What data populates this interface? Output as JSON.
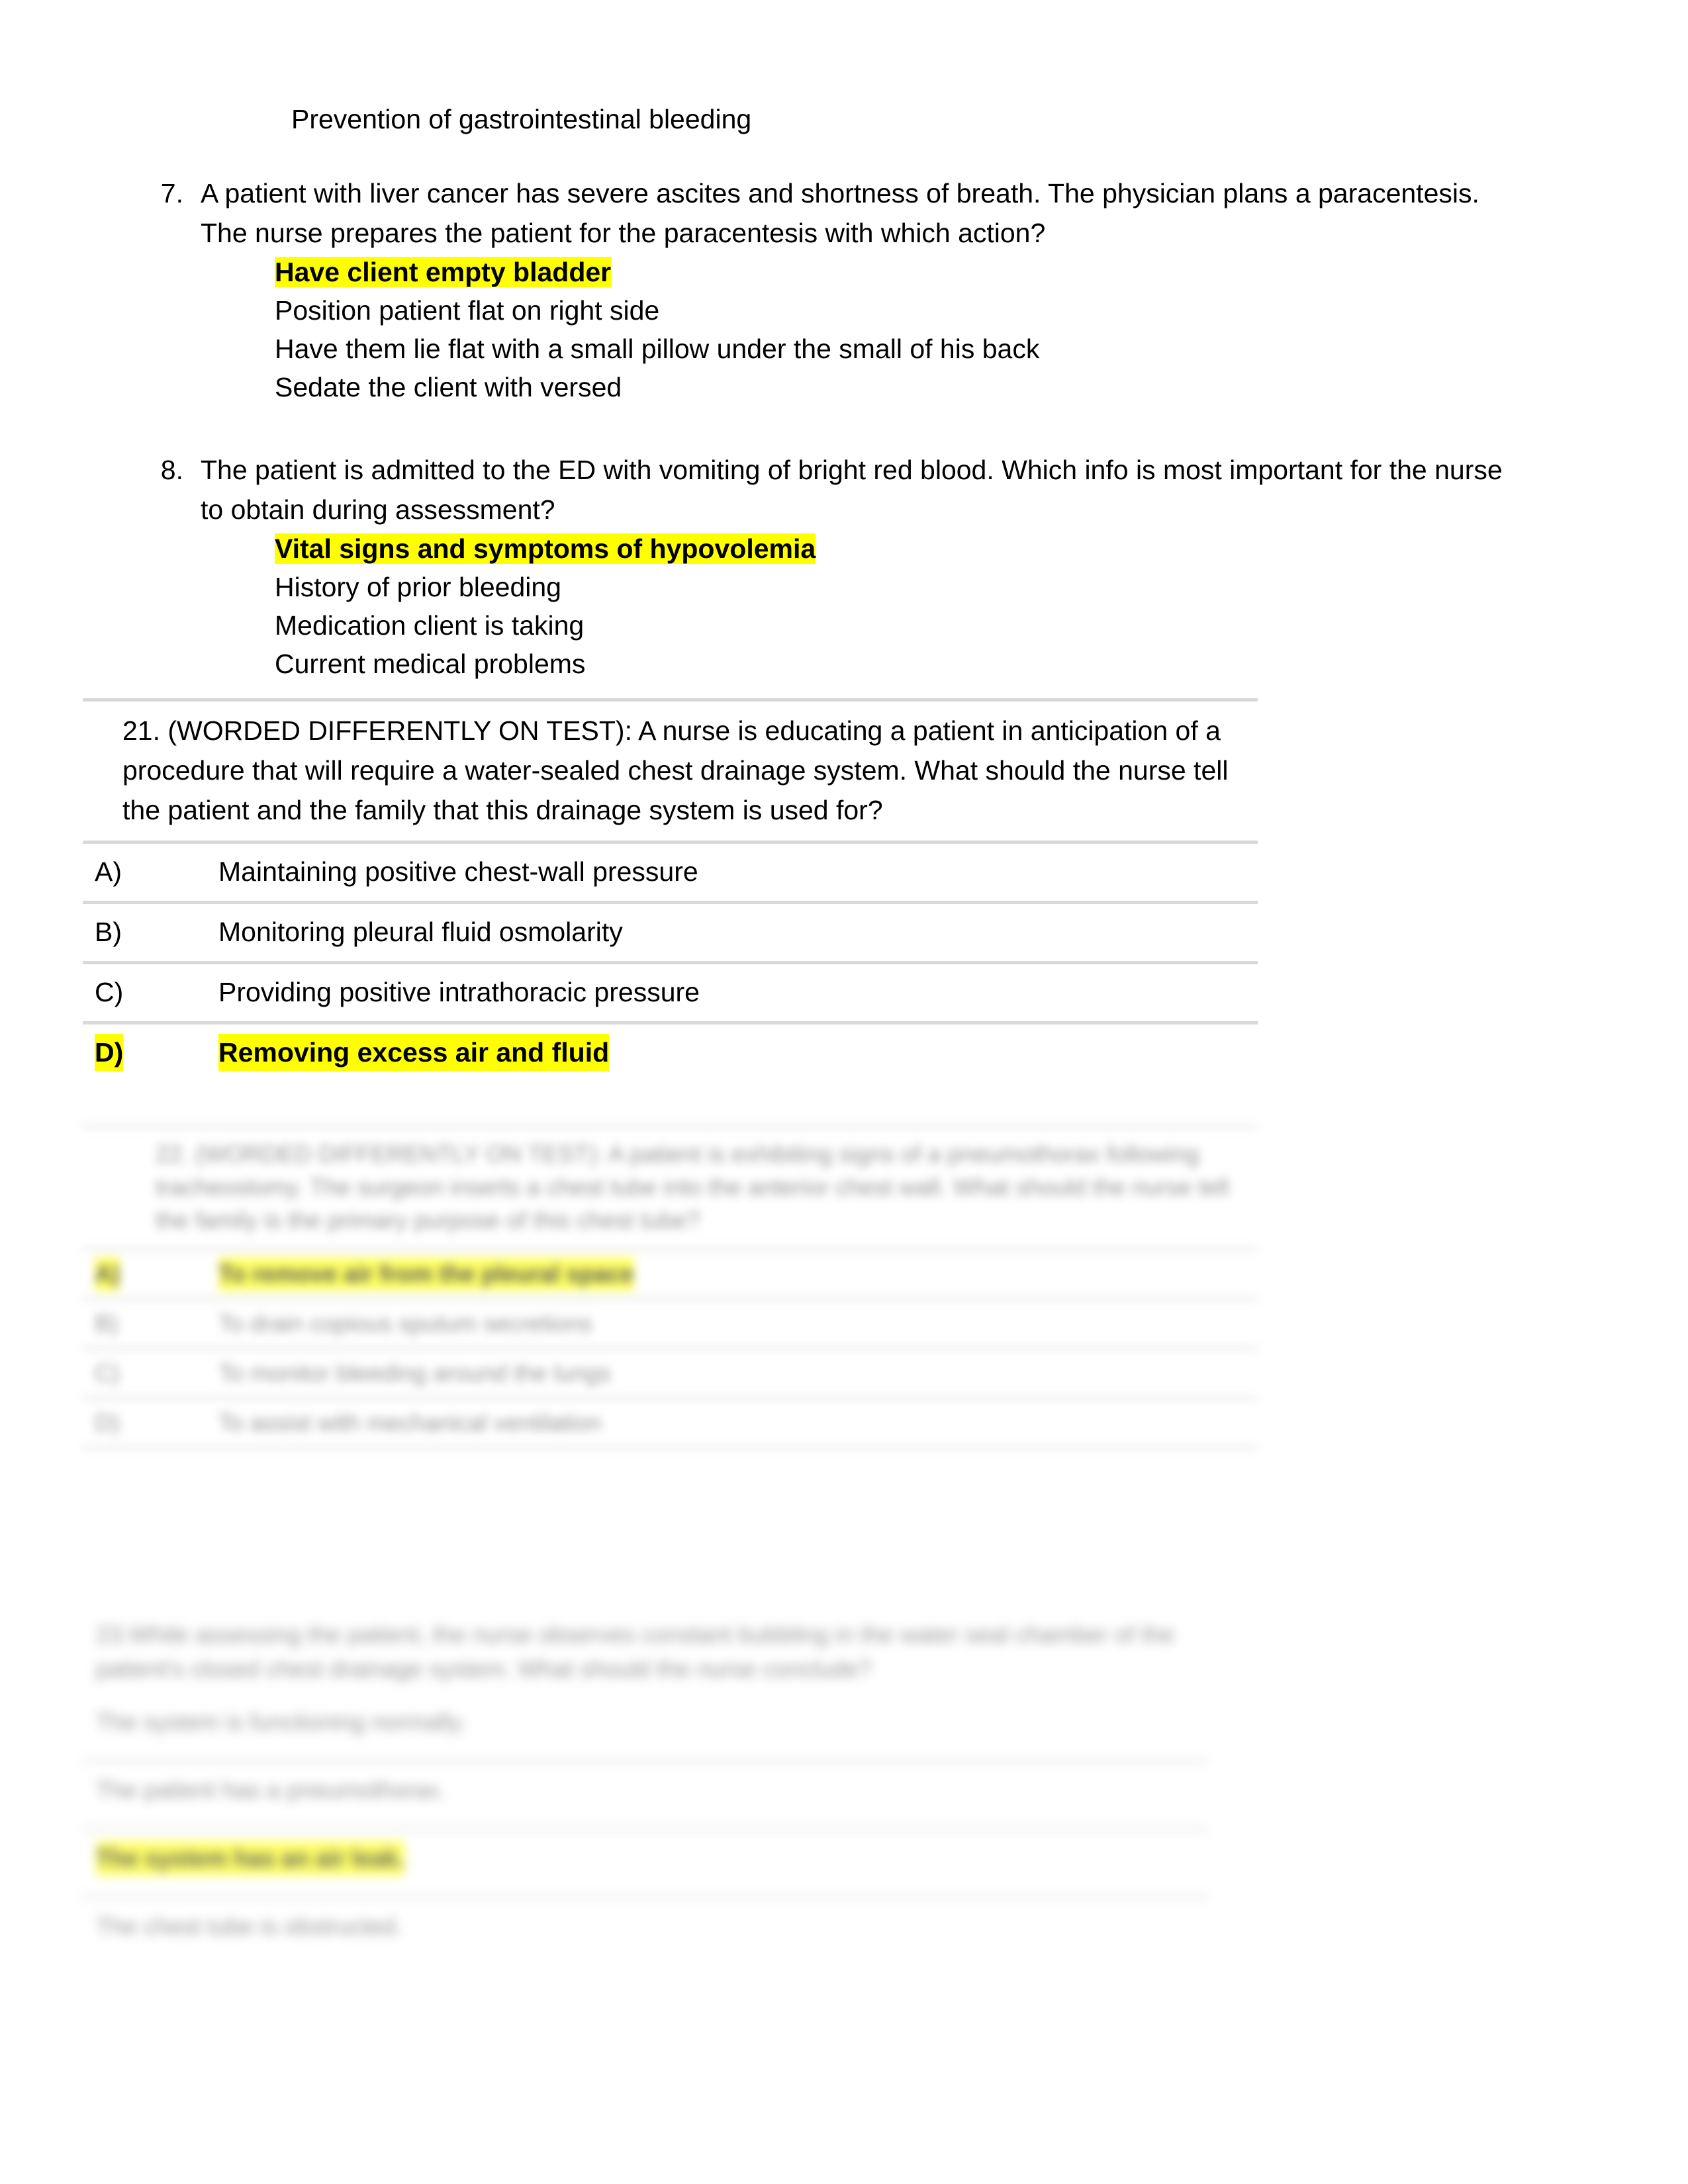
{
  "document": {
    "heading": "Prevention of gastrointestinal bleeding"
  },
  "questions": [
    {
      "number": "7.",
      "stem": "A patient with liver cancer has severe ascites and shortness of breath. The physician plans a paracentesis. The nurse prepares the patient for the paracentesis with which action?",
      "options": [
        {
          "text": "Have client empty bladder",
          "highlighted": true
        },
        {
          "text": "Position patient flat on right side",
          "highlighted": false
        },
        {
          "text": "Have them lie flat with a small pillow under the small of his back",
          "highlighted": false
        },
        {
          "text": "Sedate the client with versed",
          "highlighted": false
        }
      ]
    },
    {
      "number": "8.",
      "stem": "The patient is admitted to the ED with vomiting of bright red blood. Which info is most important for the nurse to obtain during assessment?",
      "options": [
        {
          "text": "Vital signs and symptoms of hypovolemia",
          "highlighted": true
        },
        {
          "text": "History of prior bleeding",
          "highlighted": false
        },
        {
          "text": "Medication client is taking",
          "highlighted": false
        },
        {
          "text": "Current medical problems",
          "highlighted": false
        }
      ]
    }
  ],
  "table_question": {
    "stem": "21. (WORDED DIFFERENTLY ON TEST): A nurse is educating a patient in anticipation of a procedure that will require a water-sealed chest drainage system. What should the nurse tell the patient and the family that this drainage system is used for?",
    "options": [
      {
        "letter": "A)",
        "text": "Maintaining positive chest-wall pressure",
        "highlighted": false
      },
      {
        "letter": "B)",
        "text": "Monitoring pleural fluid osmolarity",
        "highlighted": false
      },
      {
        "letter": "C)",
        "text": "Providing positive intrathoracic pressure",
        "highlighted": false
      },
      {
        "letter": "D)",
        "text": "Removing excess air and fluid",
        "highlighted": true
      }
    ]
  },
  "blurred_question_1": {
    "stem": "22. (WORDED DIFFERENTLY ON TEST): A patient is exhibiting signs of a pneumothorax following tracheostomy. The surgeon inserts a chest tube into the anterior chest wall. What should the nurse tell the family is the primary purpose of this chest tube?",
    "options": [
      {
        "letter": "A)",
        "text": "To remove air from the pleural space",
        "highlighted": true
      },
      {
        "letter": "B)",
        "text": "To drain copious sputum secretions",
        "highlighted": false
      },
      {
        "letter": "C)",
        "text": "To monitor bleeding around the lungs",
        "highlighted": false
      },
      {
        "letter": "D)",
        "text": "To assist with mechanical ventilation",
        "highlighted": false
      }
    ]
  },
  "blurred_question_2": {
    "stem": "23.While assessing the patient, the nurse observes constant bubbling in the water seal chamber of the patient's closed chest drainage system. What should the nurse conclude?",
    "options": [
      {
        "letter": "",
        "text": "The system is functioning normally.",
        "highlighted": false
      },
      {
        "letter": "",
        "text": "The patient has a pneumothorax.",
        "highlighted": false
      },
      {
        "letter": "",
        "text": "The system has an air leak.",
        "highlighted": true
      },
      {
        "letter": "",
        "text": "The chest tube is obstructed.",
        "highlighted": false
      }
    ]
  },
  "colors": {
    "highlight": "#FFFF00",
    "rule": "#d9d9d9",
    "text": "#000000"
  }
}
